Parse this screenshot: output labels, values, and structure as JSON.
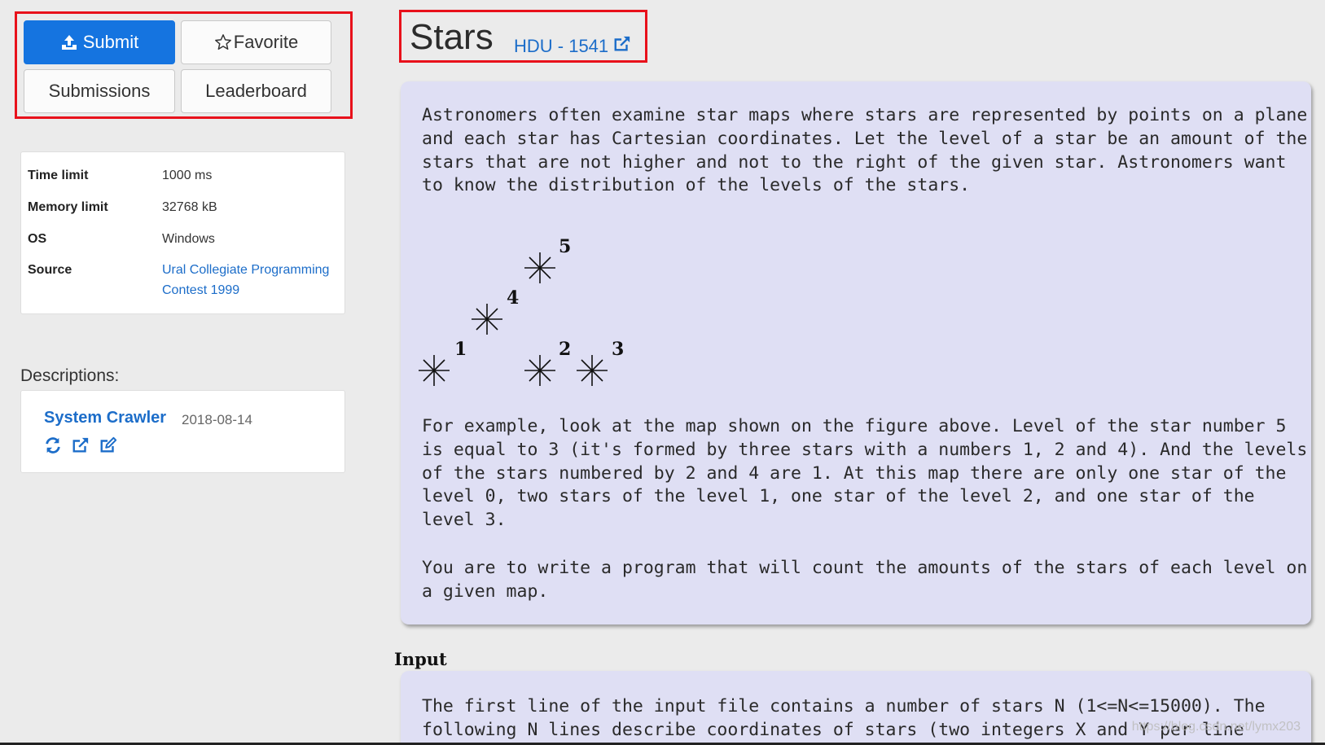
{
  "actions": {
    "submit": "Submit",
    "favorite": "Favorite",
    "submissions": "Submissions",
    "leaderboard": "Leaderboard"
  },
  "info": {
    "time_limit_label": "Time limit",
    "time_limit_value": "1000 ms",
    "memory_limit_label": "Memory limit",
    "memory_limit_value": "32768 kB",
    "os_label": "OS",
    "os_value": "Windows",
    "source_label": "Source",
    "source_value": "Ural Collegiate Programming Contest 1999"
  },
  "descriptions": {
    "title": "Descriptions:",
    "author": "System Crawler",
    "date": "2018-08-14",
    "icons": [
      "refresh-icon",
      "external-link-icon",
      "edit-icon"
    ]
  },
  "problem": {
    "title": "Stars",
    "source": "HDU - 1541",
    "paragraph1": "Astronomers often examine star maps where stars are represented by points on a plane\nand each star has Cartesian coordinates. Let the level of a star be an amount of the\nstars that are not higher and not to the right of the given star. Astronomers want\nto know the distribution of the levels of the stars.",
    "figure_labels": [
      "1",
      "2",
      "3",
      "4",
      "5"
    ],
    "paragraph2": "For example, look at the map shown on the figure above. Level of the star number 5\nis equal to 3 (it's formed by three stars with a numbers 1, 2 and 4). And the levels\nof the stars numbered by 2 and 4 are 1. At this map there are only one star of the\nlevel 0, two stars of the level 1, one star of the level 2, and one star of the\nlevel 3.",
    "paragraph3": "You are to write a program that will count the amounts of the stars of each level on\na given map."
  },
  "input_section": {
    "heading": "Input",
    "text": "The first line of the input file contains a number of stars N (1<=N<=15000). The\nfollowing N lines describe coordinates of stars (two integers X and Y per line"
  },
  "watermark": "https://blog.csdn.net/lymx203",
  "colors": {
    "primary": "#1574e0",
    "link": "#1c6dc9",
    "highlight_border": "#e8111b",
    "panel_bg": "#dfdff4",
    "page_bg": "#ebebeb"
  }
}
